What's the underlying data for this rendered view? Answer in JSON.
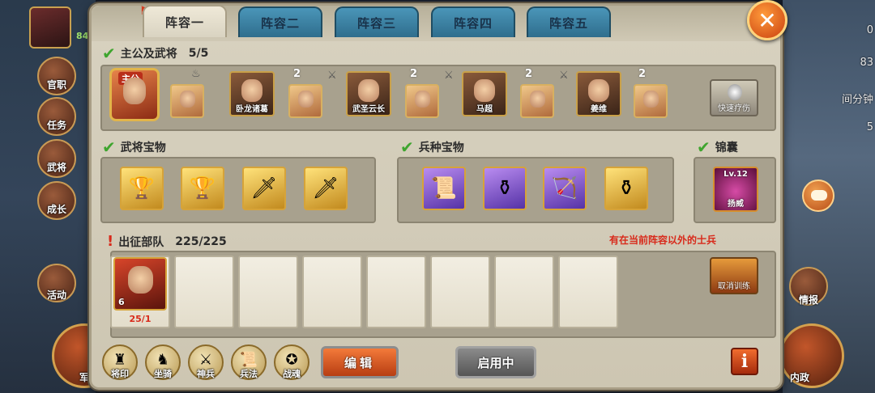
{
  "background": {
    "level_text": "84",
    "left_menu": [
      {
        "label": "官职",
        "icon": "official-icon"
      },
      {
        "label": "任务",
        "icon": "quest-icon"
      },
      {
        "label": "武将",
        "icon": "generals-icon"
      },
      {
        "label": "成长",
        "icon": "growth-icon"
      },
      {
        "label": "活动",
        "icon": "event-icon"
      }
    ],
    "bottom_left_label": "军",
    "right_texts": [
      "0",
      "83",
      "间分钟",
      "5"
    ],
    "right_menu": [
      {
        "label": "情报",
        "icon": "intel-icon"
      },
      {
        "label": "内政",
        "icon": "domestic-icon"
      }
    ]
  },
  "tabs": [
    {
      "label": "阵容一",
      "active": true
    },
    {
      "label": "阵容二",
      "active": false
    },
    {
      "label": "阵容三",
      "active": false
    },
    {
      "label": "阵容四",
      "active": false
    },
    {
      "label": "阵容五",
      "active": false
    }
  ],
  "generals_section": {
    "title": "主公及武将",
    "count": "5/5",
    "lord_tag": "主公",
    "heroes": [
      {
        "name": "卧龙诸葛",
        "badge": "2"
      },
      {
        "name": "武圣云长",
        "badge": "2"
      },
      {
        "name": "马超",
        "badge": "2"
      },
      {
        "name": "姜维",
        "badge": "2"
      }
    ],
    "quick_heal_label": "快速疗伤"
  },
  "general_treasure": {
    "title": "武将宝物",
    "items": [
      "goblet",
      "goblet",
      "sword",
      "sword"
    ]
  },
  "troop_treasure": {
    "title": "兵种宝物",
    "items": [
      "scroll",
      "cauldron",
      "bow",
      "cauldron"
    ]
  },
  "jinnang": {
    "title": "锦囊",
    "level": "Lv.12",
    "name": "扬威"
  },
  "troops_section": {
    "title": "出征部队",
    "count": "225/225",
    "warning": "有在当前阵容以外的士兵",
    "troop_level": "6",
    "troop_count": "25/1",
    "cancel_label": "取消训练"
  },
  "bottom_buttons": [
    {
      "label": "将印",
      "icon": "seal-icon"
    },
    {
      "label": "坐骑",
      "icon": "mount-icon"
    },
    {
      "label": "神兵",
      "icon": "weapon-icon"
    },
    {
      "label": "兵法",
      "icon": "strategy-icon"
    },
    {
      "label": "战魂",
      "icon": "soul-icon"
    }
  ],
  "edit_label": "编辑",
  "enable_label": "启用中",
  "colors": {
    "accent": "#f06c2e",
    "warning": "#d82a1b",
    "check": "#3ea52e",
    "tab": "#2f6e8d"
  }
}
